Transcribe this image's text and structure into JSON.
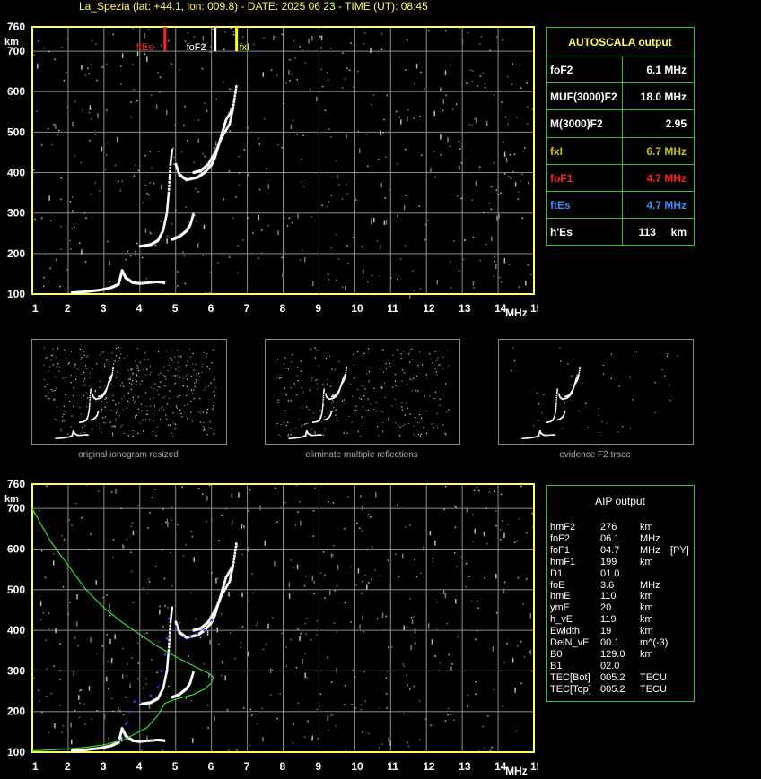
{
  "header": {
    "title": "La_Spezia (lat: +44.1, lon: 009.8) - DATE: 2025 06 23 - TIME (UT): 08:45"
  },
  "colors": {
    "axis": "#ffff55",
    "grid": "#8a8a8a",
    "panel_border": "#30c030",
    "foF1": "#ff2020",
    "ftEs": "#3a8cff",
    "fxI": "#c8c800",
    "model_profile": "#30dd30",
    "aip_trace": "#3333ff"
  },
  "chart_data": [
    {
      "type": "scatter",
      "id": "top-ionogram",
      "xlim": [
        1,
        15
      ],
      "ylim": [
        100,
        760
      ],
      "x_ticks": [
        "1",
        "2",
        "3",
        "4",
        "5",
        "6",
        "7",
        "8",
        "9",
        "10",
        "11",
        "12",
        "13",
        "14",
        "15"
      ],
      "y_ticks": [
        "100",
        "200",
        "300",
        "400",
        "500",
        "600",
        "700",
        "760"
      ],
      "x_unit": "MHz",
      "y_unit": "km",
      "grid": true,
      "markers": [
        {
          "label": "ftEs",
          "x": 4.7,
          "color": "#ff2020"
        },
        {
          "label": "foF2",
          "x": 6.1,
          "color": "#ffffff"
        },
        {
          "label": "fxI",
          "x": 6.7,
          "color": "#ffff00"
        }
      ],
      "traces": [
        {
          "name": "E",
          "points": [
            [
              2.1,
              103
            ],
            [
              2.5,
              106
            ],
            [
              2.9,
              110
            ],
            [
              3.2,
              116
            ],
            [
              3.4,
              124
            ],
            [
              3.45,
              140
            ],
            [
              3.5,
              158
            ],
            [
              3.6,
              140
            ],
            [
              3.8,
              128
            ],
            [
              4.0,
              126
            ],
            [
              4.5,
              130
            ],
            [
              4.7,
              128
            ]
          ]
        },
        {
          "name": "F1",
          "points": [
            [
              4.0,
              218
            ],
            [
              4.3,
              222
            ],
            [
              4.5,
              232
            ],
            [
              4.65,
              258
            ],
            [
              4.75,
              300
            ],
            [
              4.8,
              350
            ],
            [
              4.85,
              420
            ],
            [
              4.9,
              460
            ]
          ]
        },
        {
          "name": "F2-low",
          "points": [
            [
              4.9,
              235
            ],
            [
              5.1,
              242
            ],
            [
              5.3,
              256
            ],
            [
              5.4,
              270
            ],
            [
              5.5,
              300
            ]
          ]
        },
        {
          "name": "F2",
          "points": [
            [
              5.0,
              420
            ],
            [
              5.1,
              395
            ],
            [
              5.3,
              382
            ],
            [
              5.6,
              388
            ],
            [
              5.8,
              400
            ],
            [
              6.0,
              420
            ],
            [
              6.1,
              440
            ],
            [
              6.2,
              470
            ],
            [
              6.3,
              500
            ],
            [
              6.4,
              530
            ],
            [
              6.6,
              560
            ],
            [
              6.7,
              620
            ]
          ]
        },
        {
          "name": "F2-echo",
          "points": [
            [
              5.5,
              400
            ],
            [
              5.7,
              405
            ],
            [
              5.9,
              420
            ],
            [
              6.1,
              450
            ],
            [
              6.3,
              490
            ],
            [
              6.5,
              520
            ],
            [
              6.6,
              560
            ]
          ]
        }
      ]
    },
    {
      "type": "scatter",
      "id": "bottom-ionogram",
      "xlim": [
        1,
        15
      ],
      "ylim": [
        100,
        760
      ],
      "x_ticks": [
        "1",
        "2",
        "3",
        "4",
        "5",
        "6",
        "7",
        "8",
        "9",
        "10",
        "11",
        "12",
        "13",
        "14",
        "15"
      ],
      "y_ticks": [
        "100",
        "200",
        "300",
        "400",
        "500",
        "600",
        "700",
        "760"
      ],
      "x_unit": "MHz",
      "y_unit": "km",
      "grid": true,
      "profile": [
        [
          1.0,
          700
        ],
        [
          1.5,
          620
        ],
        [
          2.0,
          560
        ],
        [
          2.5,
          500
        ],
        [
          3.0,
          455
        ],
        [
          3.5,
          420
        ],
        [
          4.0,
          390
        ],
        [
          4.5,
          360
        ],
        [
          5.0,
          335
        ],
        [
          5.5,
          312
        ],
        [
          5.9,
          295
        ],
        [
          6.05,
          285
        ],
        [
          6.0,
          270
        ],
        [
          5.8,
          255
        ],
        [
          5.5,
          242
        ],
        [
          5.0,
          230
        ],
        [
          4.7,
          220
        ],
        [
          4.5,
          190
        ],
        [
          4.2,
          160
        ],
        [
          3.8,
          142
        ],
        [
          3.55,
          130
        ],
        [
          3.3,
          125
        ],
        [
          3.0,
          118
        ],
        [
          2.5,
          112
        ],
        [
          2.0,
          108
        ],
        [
          1.0,
          103
        ]
      ],
      "aip_points": [
        [
          3.4,
          130
        ],
        [
          3.6,
          170
        ],
        [
          3.7,
          200
        ],
        [
          3.85,
          225
        ],
        [
          4.0,
          222
        ],
        [
          4.3,
          240
        ],
        [
          4.5,
          260
        ],
        [
          4.6,
          300
        ],
        [
          4.7,
          340
        ],
        [
          4.75,
          380
        ],
        [
          4.8,
          430
        ],
        [
          5.0,
          410
        ],
        [
          5.2,
          385
        ],
        [
          5.4,
          385
        ],
        [
          5.6,
          392
        ],
        [
          5.8,
          400
        ],
        [
          6.0,
          425
        ]
      ]
    }
  ],
  "autoscala": {
    "title": "AUTOSCALA output",
    "rows": [
      {
        "label": "foF2",
        "value": "6.1 MHz",
        "color": "#ffffff"
      },
      {
        "label": "MUF(3000)F2",
        "value": "18.0 MHz",
        "color": "#ffffff"
      },
      {
        "label": "M(3000)F2",
        "value": "2.95",
        "color": "#ffffff"
      },
      {
        "label": "fxI",
        "value": "6.7 MHz",
        "color": "#c8c800"
      },
      {
        "label": "foF1",
        "value": "4.7 MHz",
        "color": "#ff2020"
      },
      {
        "label": "ftEs",
        "value": "4.7 MHz",
        "color": "#3a8cff"
      },
      {
        "label": "h'Es",
        "value": "113     km",
        "color": "#ffffff"
      }
    ]
  },
  "thumbnails": [
    {
      "caption": "original ionogram resized"
    },
    {
      "caption": "eliminate multiple reflections"
    },
    {
      "caption": "evidence F2 trace"
    }
  ],
  "aip": {
    "title": "AIP output",
    "rows": [
      {
        "name": "hmF2",
        "value": "276",
        "unit": "km",
        "flag": ""
      },
      {
        "name": "foF2",
        "value": "06.1",
        "unit": "MHz",
        "flag": ""
      },
      {
        "name": "foF1",
        "value": "04.7",
        "unit": "MHz",
        "flag": "[PY]"
      },
      {
        "name": "hmF1",
        "value": "199",
        "unit": "km",
        "flag": ""
      },
      {
        "name": "D1",
        "value": "01.0",
        "unit": "",
        "flag": ""
      },
      {
        "name": "foE",
        "value": "3.6",
        "unit": "MHz",
        "flag": ""
      },
      {
        "name": "hmE",
        "value": "110",
        "unit": "km",
        "flag": ""
      },
      {
        "name": "ymE",
        "value": "20",
        "unit": "km",
        "flag": ""
      },
      {
        "name": "h_vE",
        "value": "119",
        "unit": "km",
        "flag": ""
      },
      {
        "name": "Ewidth",
        "value": "19",
        "unit": "km",
        "flag": ""
      },
      {
        "name": "DelN_vE",
        "value": "00.1",
        "unit": "m^(-3)",
        "flag": ""
      },
      {
        "name": "B0",
        "value": "129.0",
        "unit": "km",
        "flag": ""
      },
      {
        "name": "B1",
        "value": "02.0",
        "unit": "",
        "flag": ""
      },
      {
        "name": "TEC[Bot]",
        "value": "005.2",
        "unit": "TECU",
        "flag": ""
      },
      {
        "name": "TEC[Top]",
        "value": "005.2",
        "unit": "TECU",
        "flag": ""
      }
    ]
  }
}
